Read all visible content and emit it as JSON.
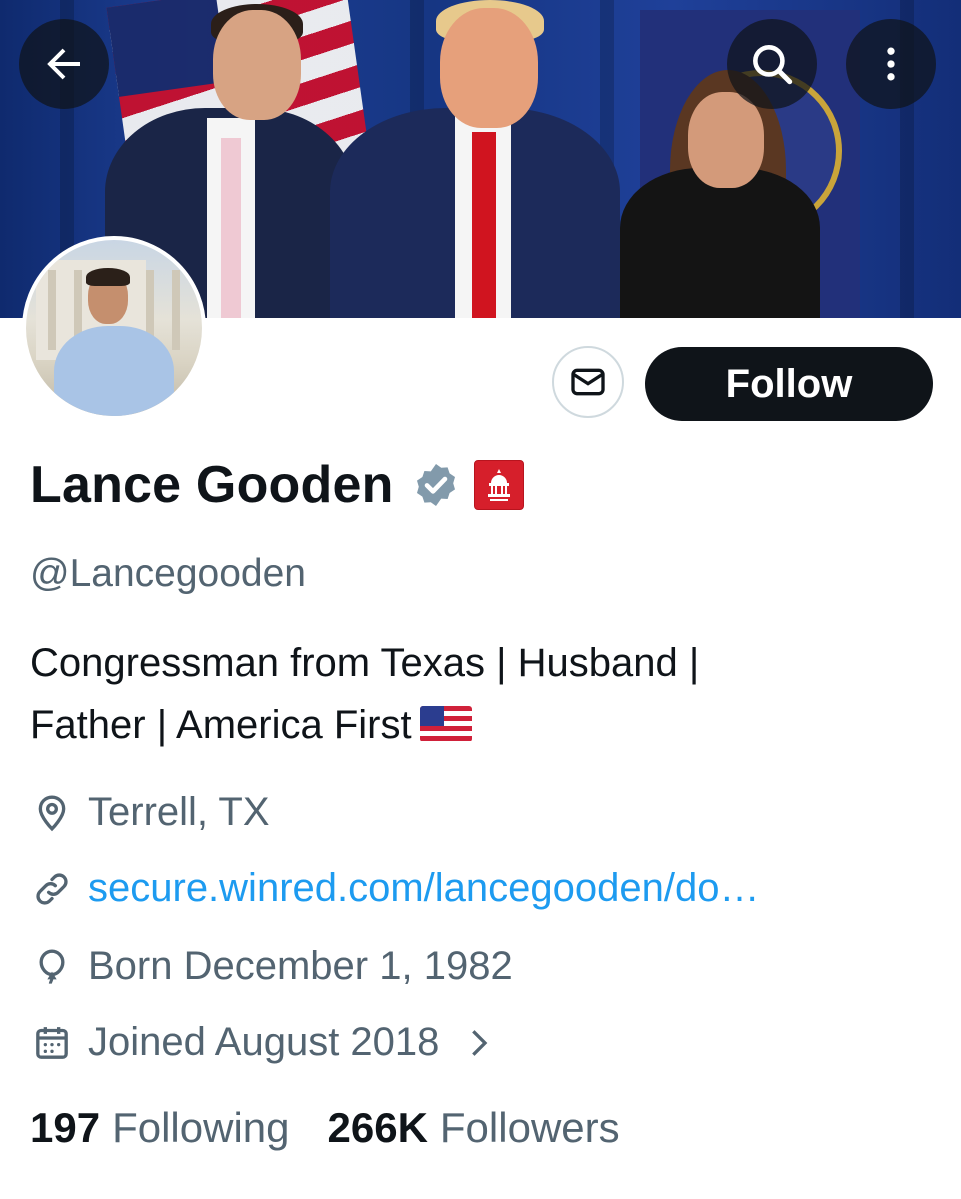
{
  "profile": {
    "name": "Lance Gooden",
    "handle": "@Lancegooden",
    "bio_line1": "Congressman from Texas | Husband |",
    "bio_line2": "Father | America First",
    "location": "Terrell, TX",
    "website": "secure.winred.com/lancegooden/do…",
    "birthday": "Born December 1, 1982",
    "joined": "Joined August 2018"
  },
  "actions": {
    "follow_label": "Follow"
  },
  "stats": {
    "following_count": "197",
    "following_label": "Following",
    "followers_count": "266K",
    "followers_label": "Followers"
  },
  "icons": {
    "back": "back-arrow-icon",
    "search": "search-icon",
    "more": "more-vertical-icon",
    "message": "envelope-icon",
    "verified": "verified-badge-icon",
    "affiliation": "house-gop-badge-icon",
    "location": "location-pin-icon",
    "link": "link-icon",
    "birthday": "balloon-icon",
    "calendar": "calendar-icon",
    "chevron": "chevron-right-icon"
  },
  "colors": {
    "text_primary": "#0f1419",
    "text_secondary": "#536471",
    "link": "#1d9bf0",
    "follow_bg": "#0f1419",
    "verified_gray": "#829aab",
    "gop_red": "#d61f2b"
  }
}
